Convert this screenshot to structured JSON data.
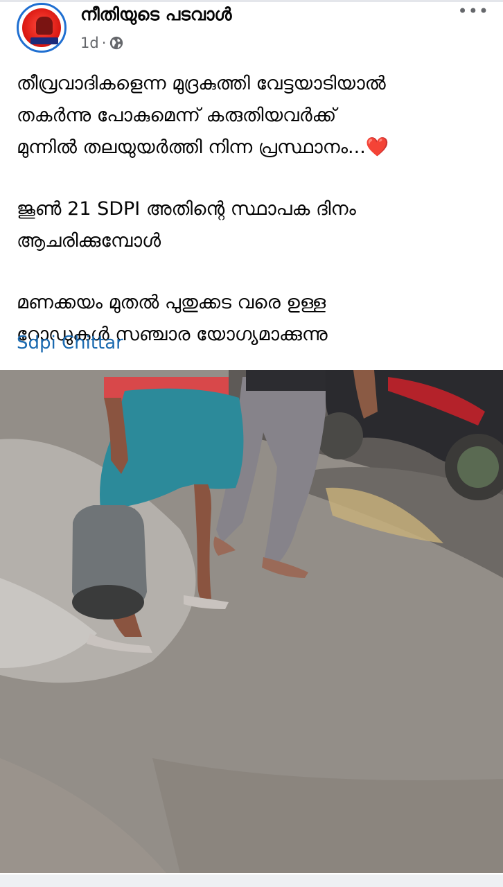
{
  "post": {
    "page_name": "നീതിയുടെ പടവാൾ",
    "time": "1d",
    "separator": "·",
    "text_lines": [
      "തീവ്രവാദികളെന്ന  മുദ്രകുത്തി വേട്ടയാടിയാൽ",
      "തകർന്നു പോകുമെന്ന് കരുതിയവർക്ക്",
      "മുന്നിൽ തലയുയർത്തി നിന്ന പ്രസ്ഥാനം...",
      "ജൂൺ 21 SDPI അതിന്റെ സ്ഥാപക ദിനം",
      "ആചരിക്കുമ്പോൾ",
      "മണക്കയം മുതൽ പുതുക്കട വരെ ഉള്ള",
      "റോഡുകൾ സഞ്ചാര യോഗ്യമാക്കുന്നു"
    ],
    "emoji": "❤️",
    "tag": "Sdpi Chittar"
  },
  "icons": {
    "avatar": "page-avatar",
    "audience": "globe-icon",
    "more": "more-options-icon"
  },
  "colors": {
    "link": "#1b6ab0",
    "meta_text": "#65676b",
    "avatar_ring": "#1f6fd1"
  }
}
